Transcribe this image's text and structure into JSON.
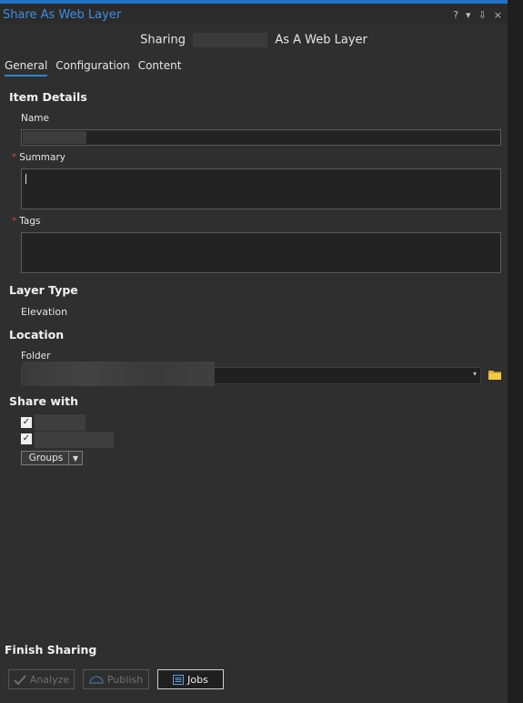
{
  "window": {
    "title": "Share As Web Layer",
    "tools": {
      "help": "?",
      "pin": "⇩",
      "close": "×"
    }
  },
  "header": {
    "sharing_prefix": "Sharing",
    "sharing_suffix": "As A Web Layer"
  },
  "tabs": [
    "General",
    "Configuration",
    "Content"
  ],
  "item_details": {
    "section": "Item Details",
    "name_label": "Name",
    "summary_label": "Summary",
    "tags_label": "Tags",
    "required_mark": "*"
  },
  "layer_type": {
    "section": "Layer Type",
    "value": "Elevation"
  },
  "location": {
    "section": "Location",
    "folder_label": "Folder"
  },
  "share_with": {
    "section": "Share with",
    "groups_label": "Groups",
    "checkboxes_checked": [
      true,
      true
    ]
  },
  "finish": {
    "section": "Finish Sharing",
    "analyze": "Analyze",
    "publish": "Publish",
    "jobs": "Jobs"
  },
  "colors": {
    "accent": "#2f86d9",
    "title": "#3a8ee6",
    "required": "#d04444",
    "folder_icon": "#e0b32f"
  }
}
